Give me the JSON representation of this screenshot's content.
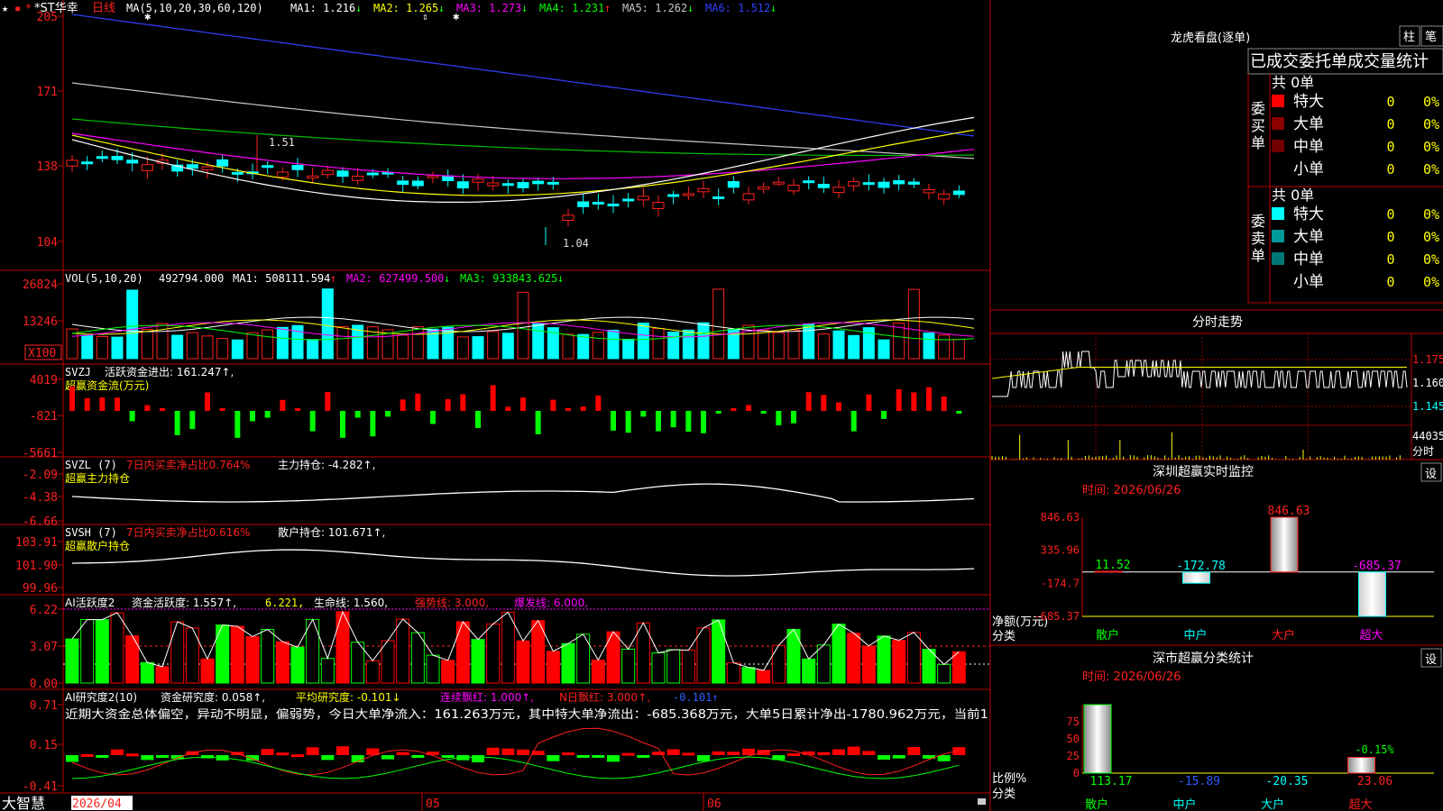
{
  "stock": {
    "name": "*ST华幸",
    "period": "日线",
    "ma_label": "MA(5,10,20,30,60,120)",
    "ma_values": [
      {
        "label": "MA1:",
        "value": "1.216",
        "arrow": "↓",
        "color": "#ffffff"
      },
      {
        "label": "MA2:",
        "value": "1.265",
        "arrow": "↓",
        "color": "#ffff00"
      },
      {
        "label": "MA3:",
        "value": "1.273",
        "arrow": "↓",
        "color": "#ff00ff"
      },
      {
        "label": "MA4:",
        "value": "1.231",
        "arrow": "↑",
        "color": "#00ff00"
      },
      {
        "label": "MA5:",
        "value": "1.262",
        "arrow": "↓",
        "color": "#c8c8c8"
      },
      {
        "label": "MA6:",
        "value": "1.512",
        "arrow": "↓",
        "color": "#3040ff"
      }
    ]
  },
  "panels": {
    "main": {
      "yticks": [
        "205",
        "171",
        "138",
        "104"
      ],
      "high_note": "1.51",
      "low_note": "1.04"
    },
    "vol": {
      "label": "VOL(5,10,20)",
      "value": "492794.000",
      "ma": [
        {
          "t": "MA1:",
          "v": "508111.594",
          "a": "↑"
        },
        {
          "t": "MA2:",
          "v": "627499.500",
          "a": "↓"
        },
        {
          "t": "MA3:",
          "v": "933843.625",
          "a": "↓"
        }
      ],
      "yticks": [
        "26824",
        "13246",
        "X100"
      ]
    },
    "svzj": {
      "label": "SVZJ",
      "text": "活跃资金进出: 161.247↑,",
      "sub": "超赢资金流(万元)",
      "yticks": [
        "4019",
        "-821",
        "-5661"
      ]
    },
    "svzl": {
      "label": "SVZL (7)",
      "t1": "7日内买卖净占比0.764%",
      "t2": "主力持仓: -4.282↑,",
      "sub": "超赢主力持仓",
      "yticks": [
        "-2.09",
        "-4.38",
        "-6.66"
      ]
    },
    "svsh": {
      "label": "SVSH (7)",
      "t1": "7日内买卖净占比0.616%",
      "t2": "散户持仓: 101.671↑,",
      "sub": "超赢散户持仓",
      "yticks": [
        "103.91",
        "101.90",
        "99.96"
      ]
    },
    "ai1": {
      "label": "AI活跃度2",
      "t1": "资金活跃度: 1.557↑,",
      "t2": "6.221,",
      "t3": "生命线: 1.560,",
      "t4": "强势线: 3.000,",
      "t5": "爆发线: 6.000,",
      "yticks": [
        "6.22",
        "3.07",
        "0.00"
      ]
    },
    "ai2": {
      "label": "AI研究度2(10)",
      "t1": "资金研究度: 0.058↑,",
      "t2": "平均研究度: -0.101↓",
      "t3": "连续飘红: 1.000↑,",
      "t4": "N日飘红: 3.000↑,",
      "t5": "-0.101↑",
      "comment": "近期大资金总体偏空，异动不明显，偏弱势，今日大单净流入：161.263万元，其中特大单净流出：-685.368万元，大单5日累计净出-1780.962万元，当前1",
      "yticks": [
        "0.71",
        "0.15",
        "-0.41"
      ]
    }
  },
  "bottom": {
    "brand": "大智慧",
    "date": "2026/04",
    "month1": "05",
    "month2": "06"
  },
  "right": {
    "longhu": {
      "title": "龙虎看盘(逐单)",
      "btn1": "柱",
      "btn2": "笔"
    },
    "orders": {
      "title": "已成交委托单成交量统计",
      "buy_label": "委买单",
      "sell_label": "委卖单",
      "buy_total": "共 0单",
      "sell_total": "共 0单",
      "buy_rows": [
        {
          "name": "特大",
          "val": "0",
          "pct": "0%",
          "color": "#ff0000"
        },
        {
          "name": "大单",
          "val": "0",
          "pct": "0%",
          "color": "#8b0000"
        },
        {
          "name": "中单",
          "val": "0",
          "pct": "0%",
          "color": "#700000"
        },
        {
          "name": "小单",
          "val": "0",
          "pct": "0%",
          "color": ""
        }
      ],
      "sell_rows": [
        {
          "name": "特大",
          "val": "0",
          "pct": "0%",
          "color": "#00ffff"
        },
        {
          "name": "大单",
          "val": "0",
          "pct": "0%",
          "color": "#009999"
        },
        {
          "name": "中单",
          "val": "0",
          "pct": "0%",
          "color": "#007777"
        },
        {
          "name": "小单",
          "val": "0",
          "pct": "0%",
          "color": ""
        }
      ]
    },
    "fenshi": {
      "title": "分时走势",
      "prices": [
        "1.175",
        "1.160",
        "1.145"
      ],
      "vol": "44035",
      "vol_label": "分时"
    },
    "monitor": {
      "title": "深圳超赢实时监控",
      "btn": "设",
      "time": "时间: 2026/06/26",
      "ylabel": "净额(万元)",
      "xlabel": "分类"
    },
    "stats": {
      "title": "深市超赢分类统计",
      "btn": "设",
      "time": "时间: 2026/06/26",
      "ylabel": "比例%",
      "xlabel": "分类"
    }
  },
  "chart_data": [
    {
      "type": "bar",
      "title": "深圳超赢实时监控",
      "categories": [
        "散户",
        "中户",
        "大户",
        "超大"
      ],
      "values": [
        11.52,
        -172.78,
        846.63,
        -685.37
      ],
      "value_labels": [
        "11.52",
        "-172.78",
        "846.63",
        "-685.37"
      ],
      "yticks": [
        "846.63",
        "335.96",
        "-174.7",
        "-685.37"
      ],
      "ylim": [
        -685.37,
        846.63
      ]
    },
    {
      "type": "bar",
      "title": "深市超赢分类统计",
      "categories": [
        "散户",
        "中户",
        "大户",
        "超大"
      ],
      "values": [
        113.17,
        -15.89,
        -20.35,
        23.06
      ],
      "value_labels": [
        "113.17",
        "-15.89",
        "-20.35",
        "23.06"
      ],
      "bar_note": "-0.15%",
      "yticks": [
        "75",
        "50",
        "25",
        "0"
      ],
      "ylim": [
        0,
        100
      ]
    }
  ]
}
